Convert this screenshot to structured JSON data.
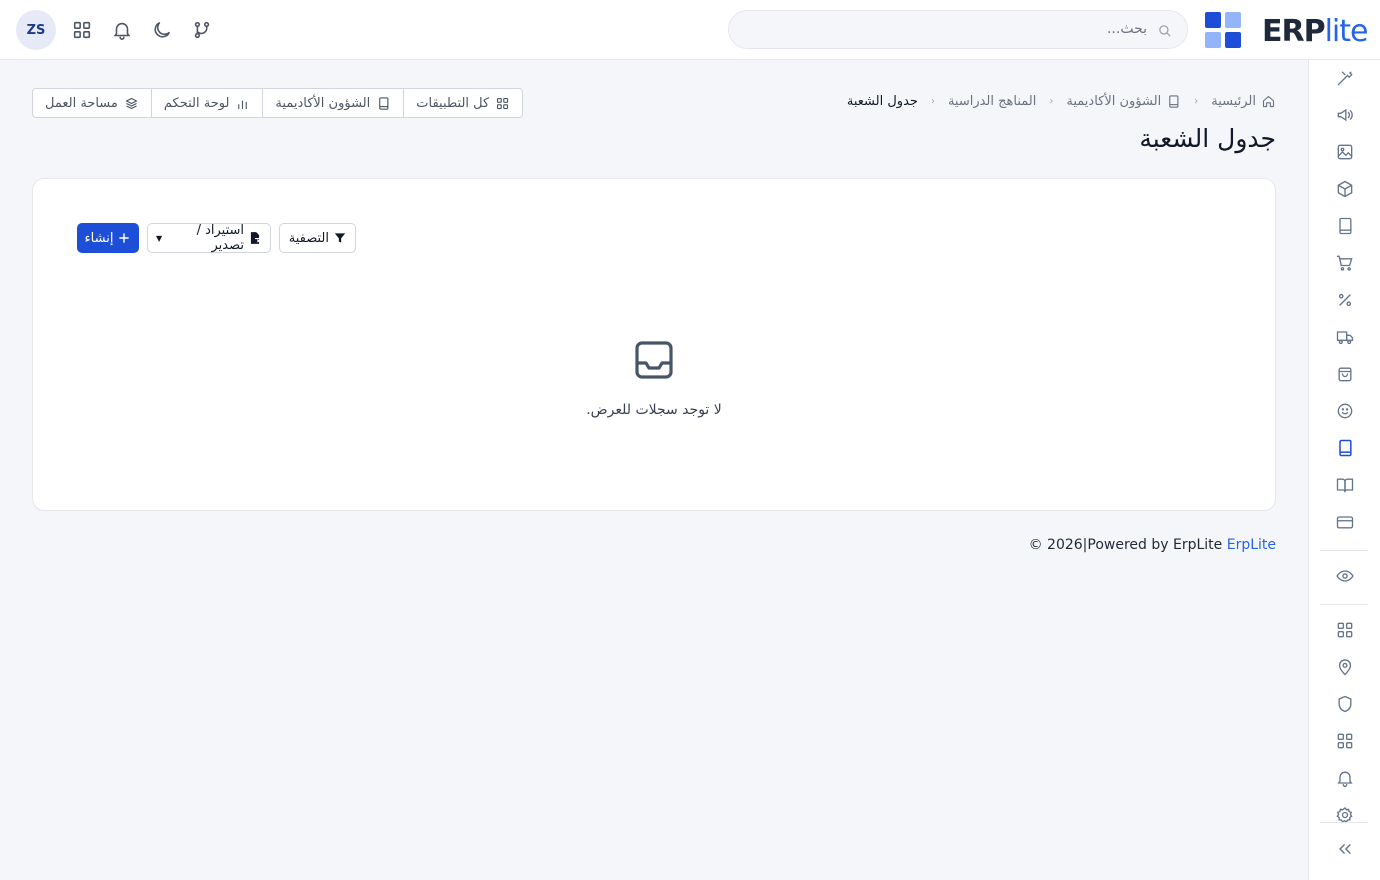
{
  "app": {
    "logo_main": "ERP",
    "logo_accent": "lite",
    "brand_colors": [
      "#1d4ed8",
      "#93b4f8"
    ],
    "user_initials": "ZS"
  },
  "header": {
    "search_placeholder": "بحث...",
    "icons": [
      "git-branch-icon",
      "moon-icon",
      "bell-icon",
      "apps-grid-icon"
    ]
  },
  "breadcrumb": {
    "items": [
      {
        "label": "الرئيسية",
        "icon": "home-icon"
      },
      {
        "label": "الشؤون الأكاديمية",
        "icon": "book-icon"
      },
      {
        "label": "المناهج الدراسية",
        "icon": ""
      },
      {
        "label": "جدول الشعبة",
        "icon": ""
      }
    ]
  },
  "page": {
    "title": "جدول الشعبة"
  },
  "quick_nav": {
    "items": [
      {
        "label": "كل التطبيقات",
        "icon": "grid-icon"
      },
      {
        "label": "الشؤون الأكاديمية",
        "icon": "book-icon"
      },
      {
        "label": "لوحة التحكم",
        "icon": "bar-chart-icon"
      },
      {
        "label": "مساحة العمل",
        "icon": "layers-icon"
      }
    ]
  },
  "toolbar": {
    "create_label": "إنشاء",
    "import_export_label": "استيراد / تصدير",
    "filter_label": "التصفية"
  },
  "empty_state": {
    "message": "لا توجد سجلات للعرض.",
    "icon": "inbox-icon"
  },
  "footer": {
    "brand_link": "ErpLite",
    "text": " © 2026|Powered by ErpLite"
  },
  "sidebar": {
    "icons": [
      "tools-icon",
      "megaphone-icon",
      "image-icon",
      "package-icon",
      "notebook-icon",
      "cart-icon",
      "percent-icon",
      "truck-icon",
      "shopping-bag-icon",
      "smile-icon",
      "book-icon",
      "book-open-icon",
      "credit-card-icon",
      "eye-icon",
      "grid-icon",
      "map-pin-icon",
      "shield-icon",
      "grid-icon",
      "bell-icon",
      "settings-icon",
      "collapse-icon"
    ],
    "active_item": "book-icon"
  }
}
